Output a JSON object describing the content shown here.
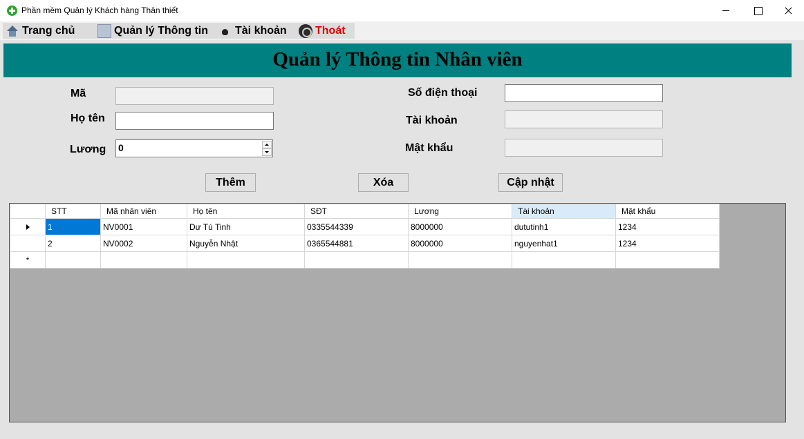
{
  "window": {
    "title": "Phần mềm Quản lý Khách hàng Thân thiết"
  },
  "menu": {
    "home": "Trang chủ",
    "info": "Quản lý Thông tin",
    "account": "Tài khoản",
    "exit": "Thoát"
  },
  "header": {
    "title": "Quản lý Thông tin Nhân viên"
  },
  "form": {
    "ma_label": "Mã",
    "ma_value": "",
    "hoten_label": "Họ tên",
    "hoten_value": "",
    "luong_label": "Lương",
    "luong_value": "0",
    "sdt_label": "Số điện thoại",
    "sdt_value": "",
    "taikhoan_label": "Tài khoản",
    "taikhoan_value": "",
    "matkhau_label": "Mật khẩu",
    "matkhau_value": ""
  },
  "buttons": {
    "add": "Thêm",
    "delete": "Xóa",
    "update": "Cập nhật"
  },
  "grid": {
    "columns": [
      "STT",
      "Mã nhân viên",
      "Họ tên",
      "SĐT",
      "Lương",
      "Tài khoản",
      "Mật khẩu"
    ],
    "rows": [
      [
        "1",
        "NV0001",
        "Dư Tú Tinh",
        "0335544339",
        "8000000",
        "dututinh1",
        "1234"
      ],
      [
        "2",
        "NV0002",
        "Nguyễn Nhật",
        "0365544881",
        "8000000",
        "nguyenhat1",
        "1234"
      ]
    ],
    "new_row_marker": "*"
  },
  "colors": {
    "header_band": "#008080",
    "exit_text": "#e00000",
    "selection": "#0078d7"
  }
}
